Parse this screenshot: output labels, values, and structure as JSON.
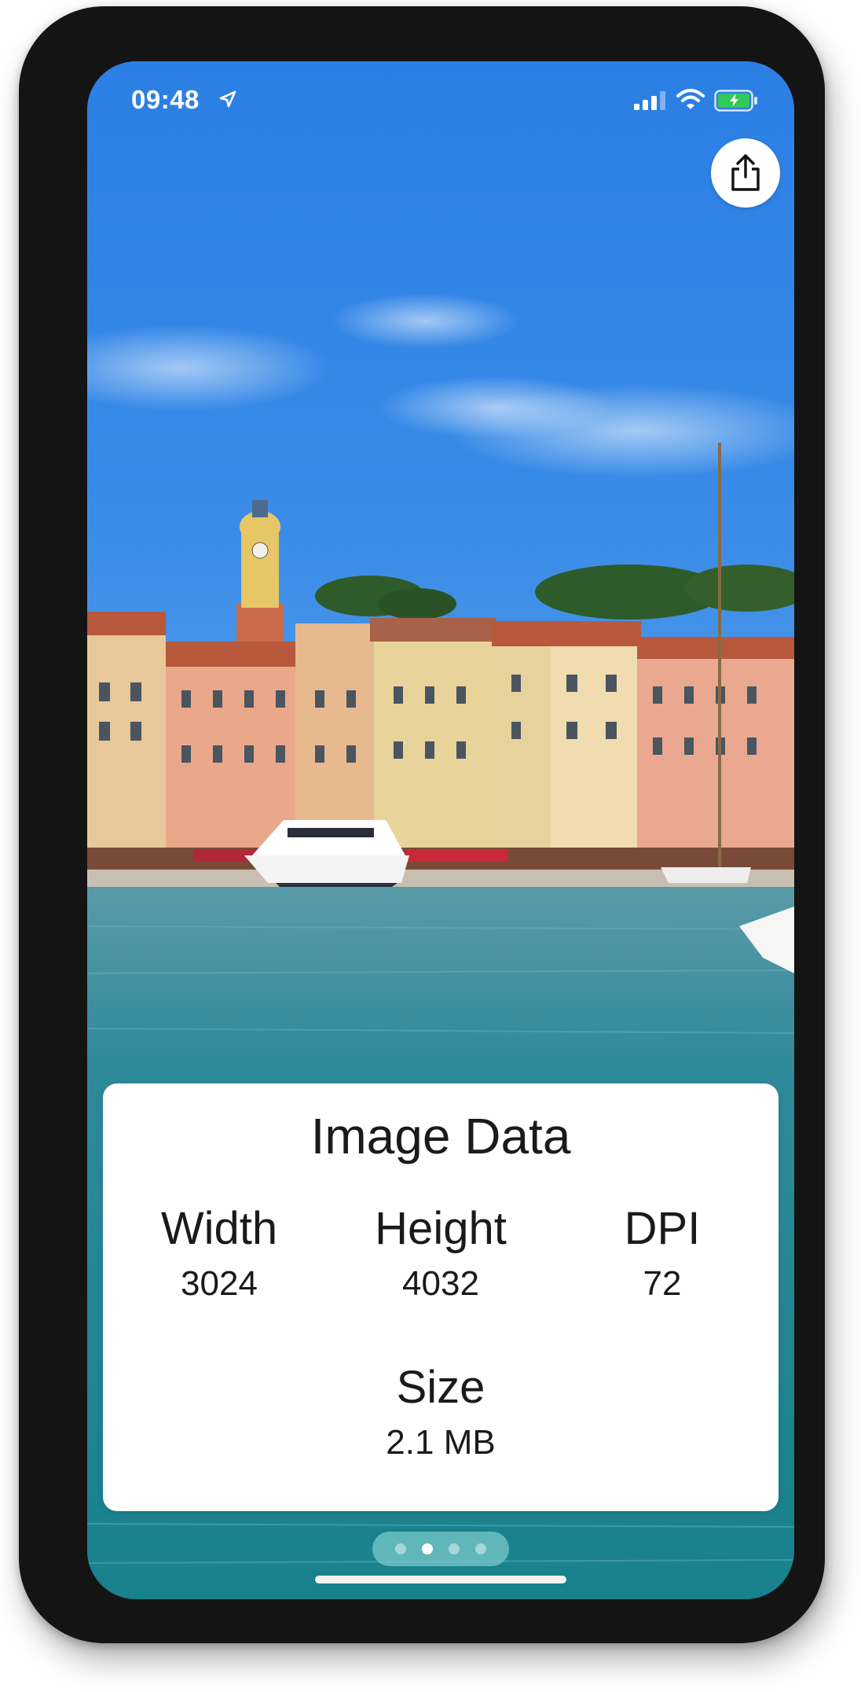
{
  "status_bar": {
    "time": "09:48",
    "icons": [
      "location-arrow-icon",
      "cellular-signal-icon",
      "wifi-icon",
      "battery-charging-icon"
    ],
    "battery_color": "#34c759"
  },
  "share_button": {
    "icon": "share-icon"
  },
  "photo": {
    "subject": "harbor-photo"
  },
  "info_card": {
    "title": "Image Data",
    "width_label": "Width",
    "width_value": "3024",
    "height_label": "Height",
    "height_value": "4032",
    "dpi_label": "DPI",
    "dpi_value": "72",
    "size_label": "Size",
    "size_value": "2.1 MB"
  },
  "pager": {
    "page_count": 4,
    "current_page": 2
  }
}
